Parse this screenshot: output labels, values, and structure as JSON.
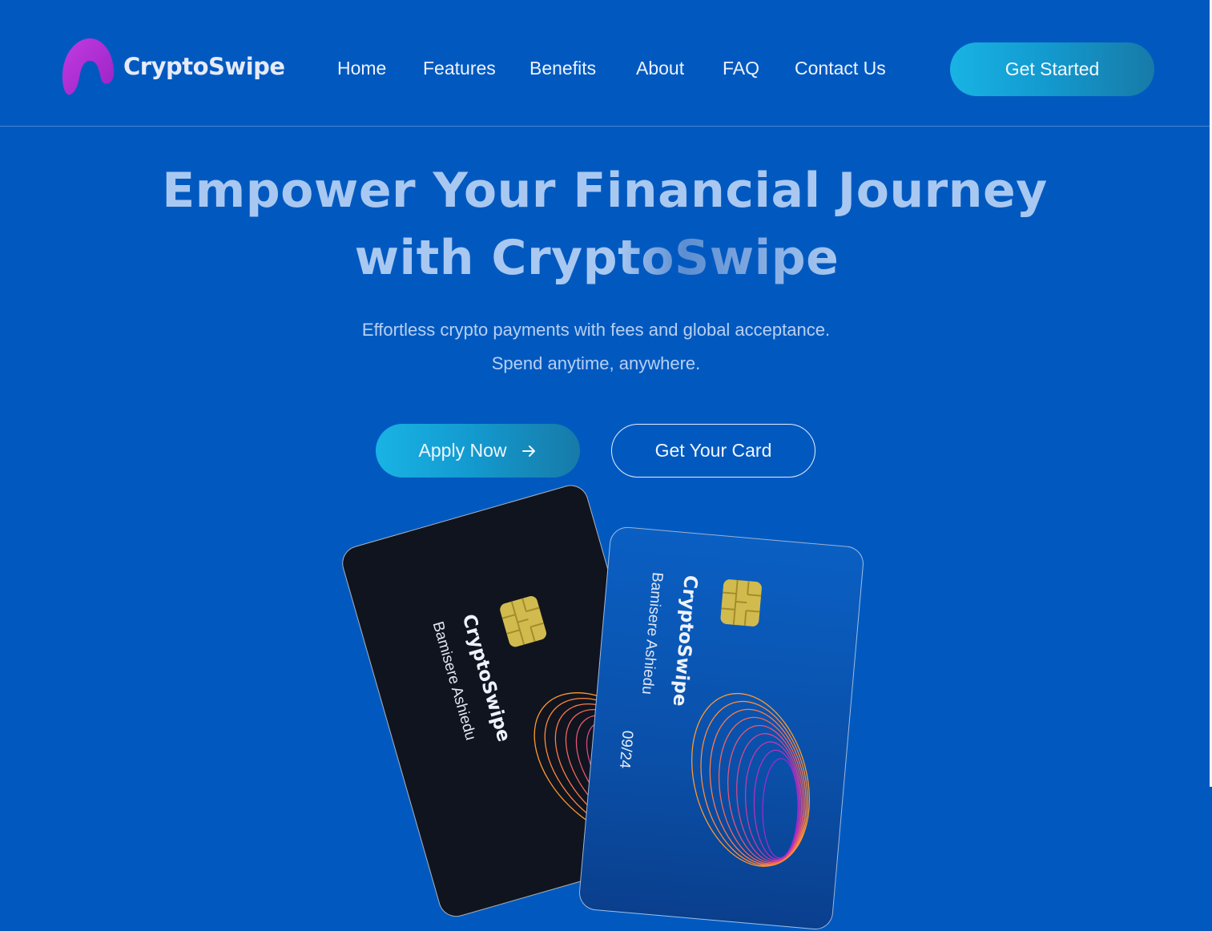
{
  "brand": {
    "name": "CryptoSwipe",
    "logo_icon": "arch-logo-icon",
    "logo_color": "#b62ed6"
  },
  "nav": {
    "items": [
      {
        "label": "Home"
      },
      {
        "label": "Features"
      },
      {
        "label": "Benefits"
      },
      {
        "label": "About"
      },
      {
        "label": "FAQ"
      },
      {
        "label": "Contact Us"
      }
    ],
    "cta_label": "Get Started"
  },
  "hero": {
    "title_line1": "Empower Your Financial Journey",
    "title_line2_prefix": "with Cryp",
    "title_line2_fade": "toSwipe",
    "subtitle_line1": "Effortless crypto payments with fees and global acceptance.",
    "subtitle_line2": "Spend anytime, anywhere.",
    "primary_button": "Apply Now",
    "primary_button_icon": "arrow-right-icon",
    "secondary_button": "Get Your Card"
  },
  "cards": [
    {
      "brand": "CryptoSwipe",
      "holder": "Bamisere Ashiedu",
      "style": "dark"
    },
    {
      "brand": "CryptoSwipe",
      "holder": "Bamisere Ashiedu",
      "expiry": "09/24",
      "style": "blue"
    }
  ],
  "colors": {
    "background": "#0159c0",
    "accent_gradient_start": "#19b3e4",
    "accent_gradient_end": "#177aa8",
    "title": "#a9c8f1"
  }
}
